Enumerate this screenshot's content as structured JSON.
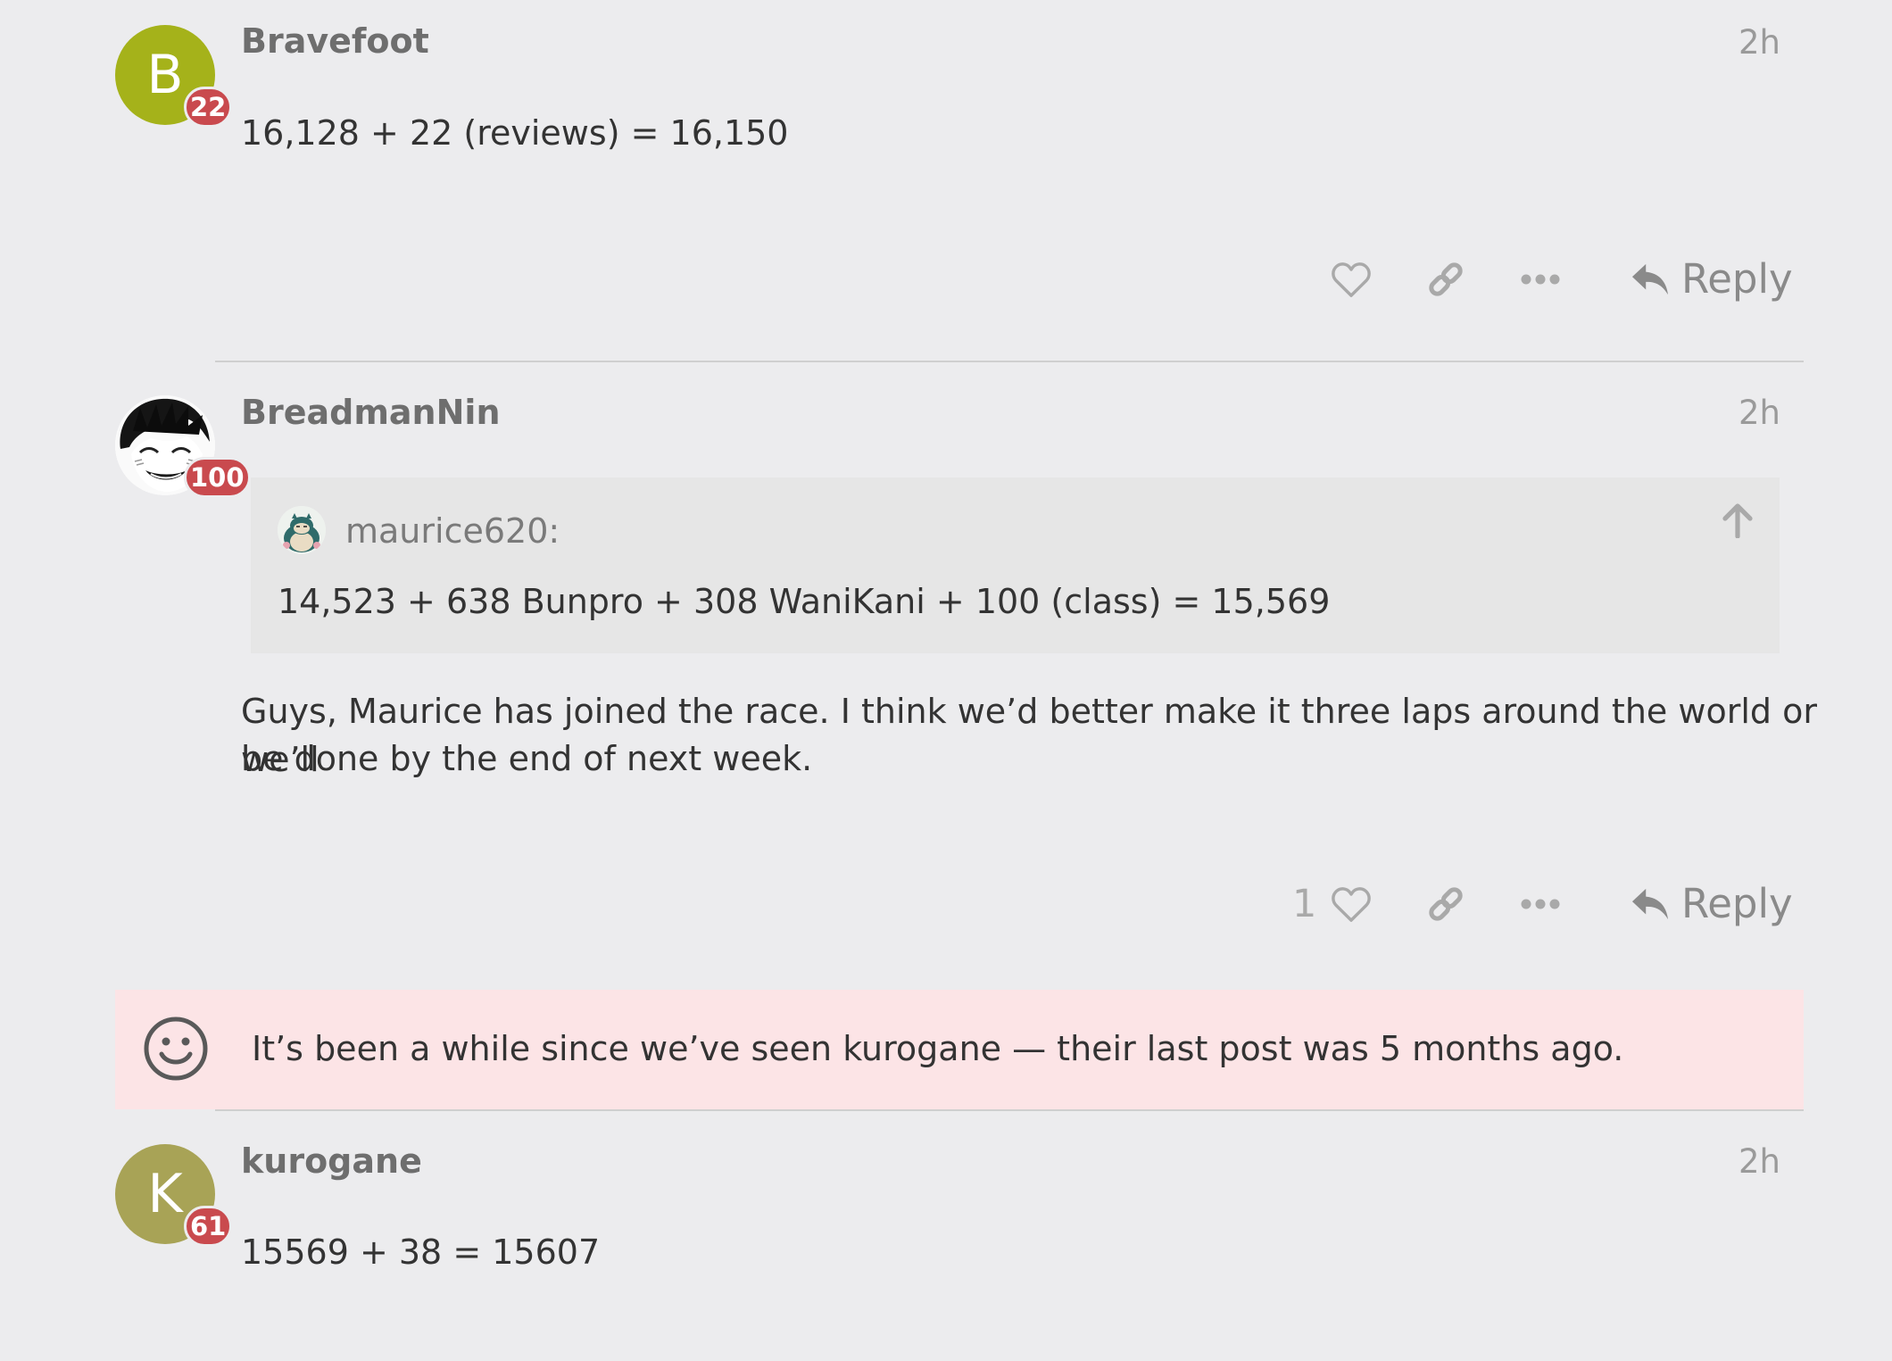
{
  "posts": [
    {
      "username": "Bravefoot",
      "avatar_letter": "B",
      "avatar_color": "#a5b21a",
      "badge": "22",
      "time": "2h",
      "body": "16,128 + 22 (reviews) = 16,150",
      "actions": {
        "reply_label": "Reply"
      }
    },
    {
      "username": "BreadmanNin",
      "badge": "100",
      "time": "2h",
      "quote": {
        "author": "maurice620:",
        "text": "14,523 + 638 Bunpro + 308 WaniKani + 100 (class) = 15,569"
      },
      "body_line1": "Guys, Maurice has joined the race. I think we’d better make it three laps around the world or we’ll",
      "body_line2": "be done by the end of next week.",
      "actions": {
        "like_count": "1",
        "reply_label": "Reply"
      }
    },
    {
      "username": "kurogane",
      "avatar_letter": "K",
      "avatar_color": "#a8a356",
      "badge": "61",
      "time": "2h",
      "body": "15569 + 38 = 15607"
    }
  ],
  "notice": {
    "text": "It’s been a while since we’ve seen kurogane — their last post was 5 months ago.",
    "background": "#fce4e6"
  },
  "colors": {
    "badge": "#c94a4e",
    "page_background": "#ececee"
  }
}
